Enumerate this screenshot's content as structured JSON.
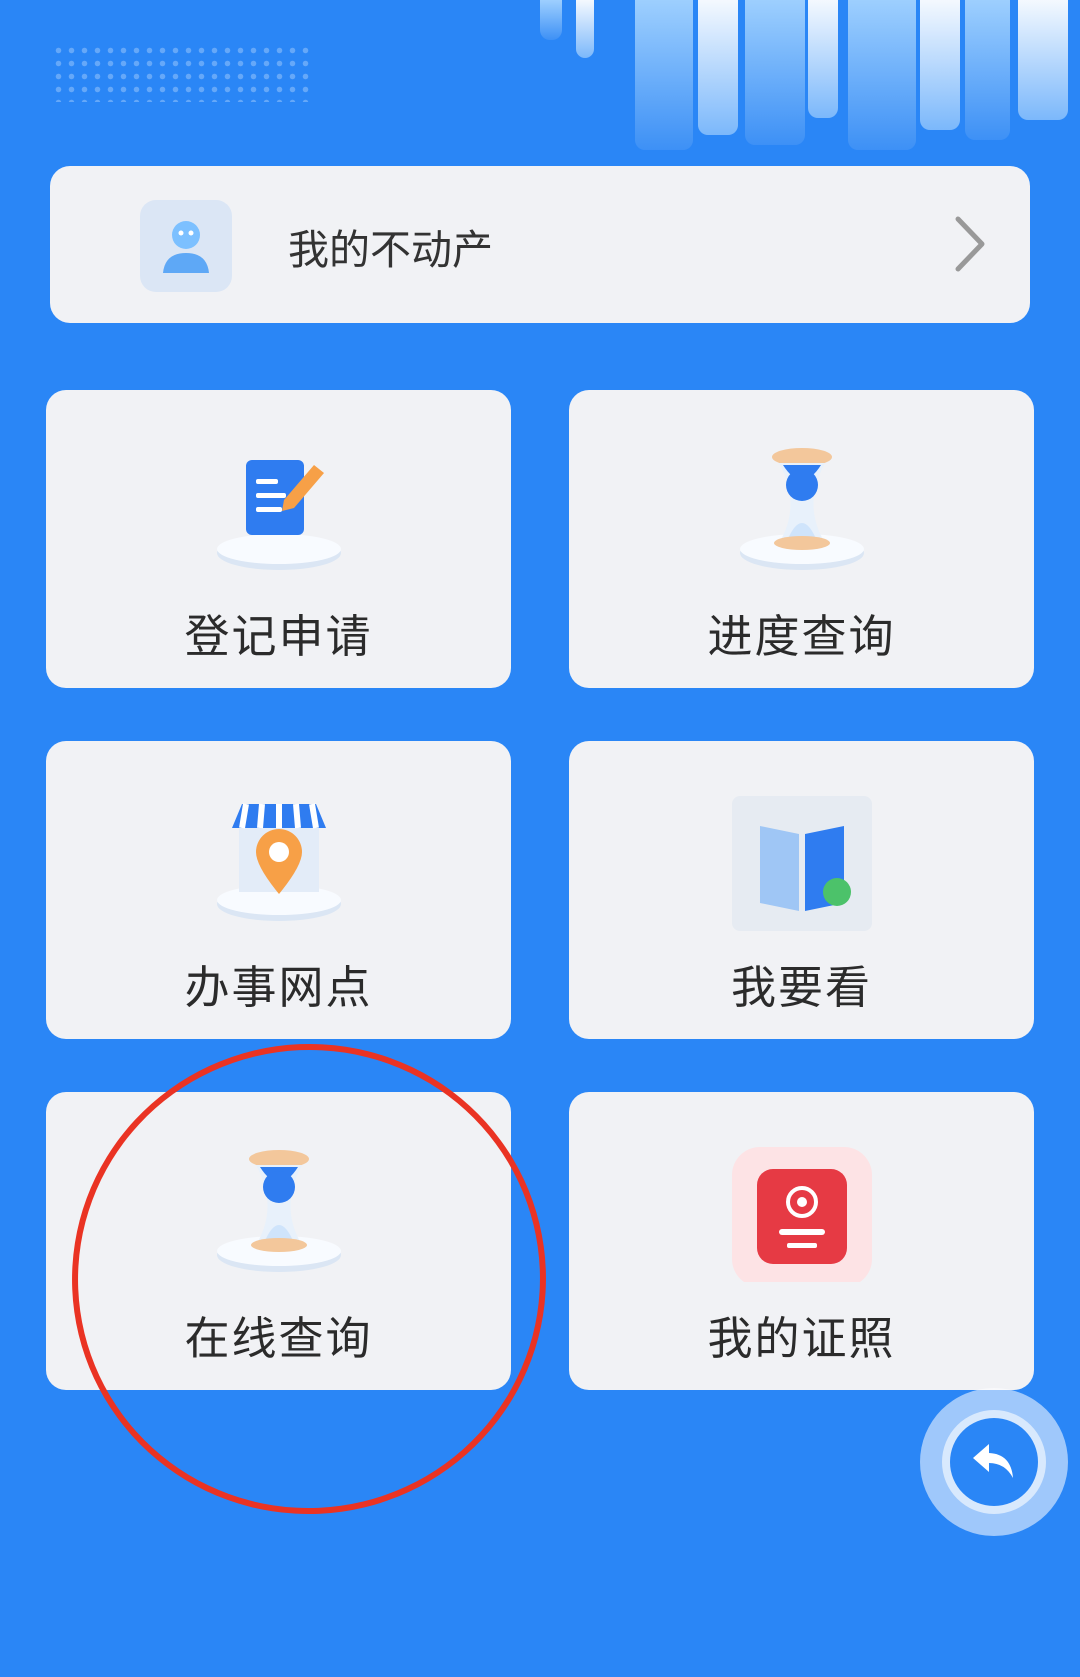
{
  "header": {
    "decoration": "city-skyline"
  },
  "my_property": {
    "label": "我的不动产",
    "icon": "user-avatar-icon"
  },
  "services": [
    {
      "label": "登记申请",
      "icon": "document-edit-icon"
    },
    {
      "label": "进度查询",
      "icon": "hourglass-icon"
    },
    {
      "label": "办事网点",
      "icon": "store-location-icon"
    },
    {
      "label": "我要看",
      "icon": "book-icon"
    },
    {
      "label": "在线查询",
      "icon": "hourglass-icon"
    },
    {
      "label": "我的证照",
      "icon": "certificate-icon"
    }
  ],
  "annotation": {
    "type": "circle",
    "color": "#ea3323",
    "target": "在线查询"
  },
  "colors": {
    "background": "#2a86f6",
    "card": "#f1f2f5",
    "accent_orange": "#f7a047"
  },
  "floating_button": {
    "icon": "back-arrow-icon"
  }
}
